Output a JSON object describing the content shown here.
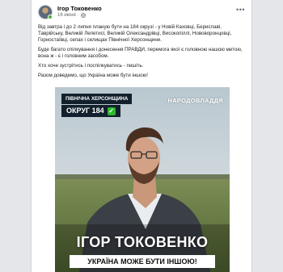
{
  "post": {
    "author": "Ігор Токовенко",
    "timestamp": "16 июня",
    "privacy_icon": "globe-icon",
    "more_icon": "more-icon",
    "paragraphs": [
      "Від завтра і до 2 липня планую бути на 184 окрузі - у Новій Каховці, Бериславі, Таврійську, Великій Лепетисі, Великій Олександрівці, Високопіллі, Нововоронцовці, Горностаївці, селах і селищах Північної Херсонщини.",
      "Буде багато спілкування і донесення ПРАВДИ, перемога якої є головною нашою метою, вона ж - є і головним засобом.",
      "Хто хоче зустрітись і поспілкуватись - пишіть.",
      "Разом доведемо, що Україна може бути іншою!"
    ]
  },
  "image": {
    "region_label": "ПІВНІЧНА ХЕРСОНЩИНА",
    "district_label": "ОКРУГ 184",
    "check_icon": "check-icon",
    "check_glyph": "✓",
    "brand": "НАРОДОВЛАДДЯ",
    "name": "ІГОР ТОКОВЕНКО",
    "slogan": "УКРАЇНА МОЖЕ БУТИ ІНШОЮ!"
  }
}
